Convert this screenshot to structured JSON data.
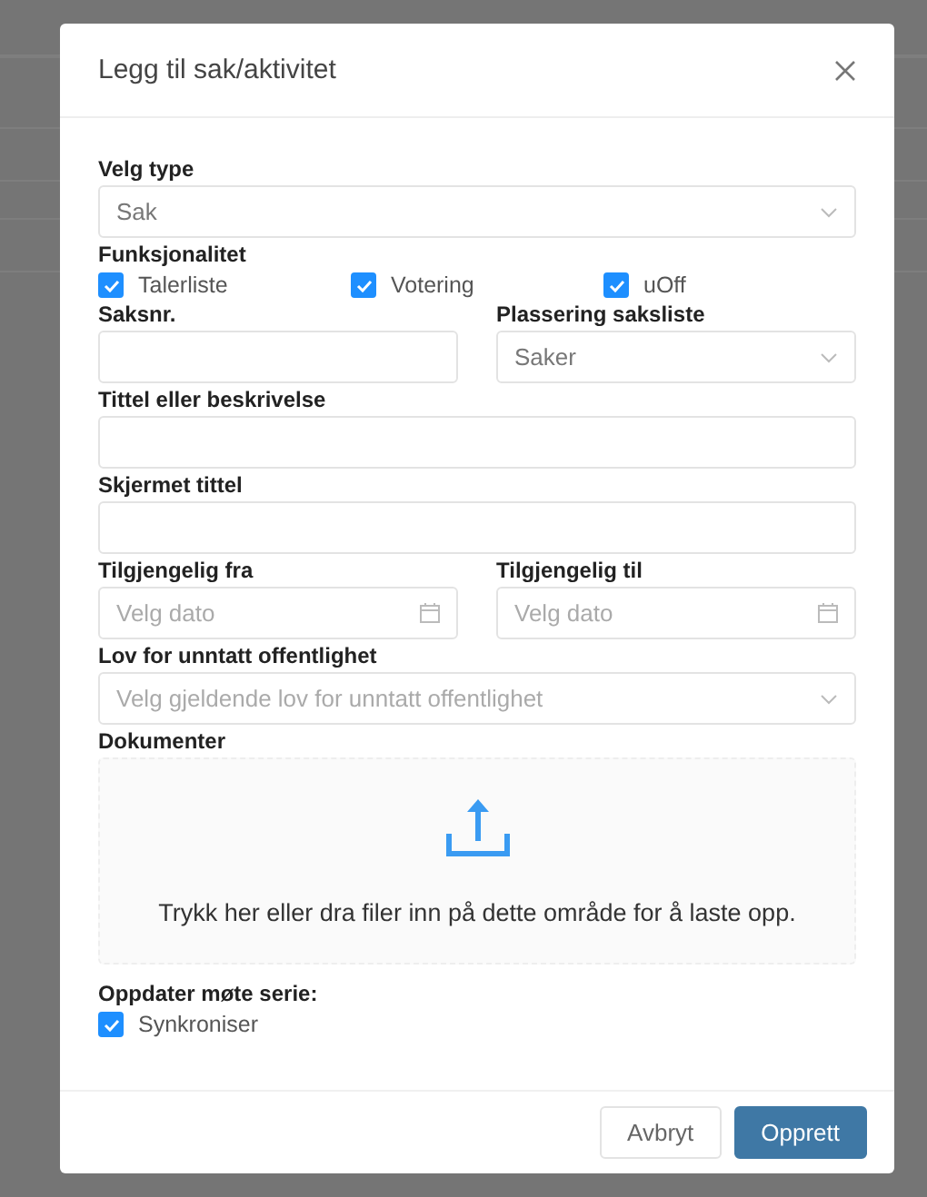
{
  "dialog": {
    "title": "Legg til sak/aktivitet"
  },
  "fields": [
    {
      "kind": "select",
      "label": "Velg type",
      "value": "Sak"
    },
    {
      "kind": "checkboxes",
      "label": "Funksjonalitet",
      "options": [
        {
          "label": "Talerliste",
          "checked": true
        },
        {
          "label": "Votering",
          "checked": true
        },
        {
          "label": "uOff",
          "checked": true
        }
      ]
    },
    {
      "kind": "row",
      "fields": [
        {
          "kind": "text",
          "label": "Saksnr."
        },
        {
          "kind": "select",
          "label": "Plassering saksliste",
          "value": "Saker"
        }
      ]
    },
    {
      "kind": "text",
      "label": "Tittel eller beskrivelse"
    },
    {
      "kind": "text",
      "label": "Skjermet tittel"
    },
    {
      "kind": "row",
      "fields": [
        {
          "kind": "date",
          "label": "Tilgjengelig fra",
          "placeholder": "Velg dato"
        },
        {
          "kind": "date",
          "label": "Tilgjengelig til",
          "placeholder": "Velg dato"
        }
      ]
    },
    {
      "kind": "select",
      "label": "Lov for unntatt offentlighet",
      "placeholder": "Velg gjeldende lov for unntatt offentlighet"
    },
    {
      "kind": "upload",
      "label": "Dokumenter",
      "text": "Trykk her eller dra filer inn på dette område for å laste opp."
    },
    {
      "kind": "checkboxes",
      "label": "Oppdater møte serie:",
      "options": [
        {
          "label": "Synkroniser",
          "checked": true
        }
      ]
    }
  ],
  "buttons": [
    {
      "label": "Avbryt",
      "kind": "secondary"
    },
    {
      "label": "Opprett",
      "kind": "primary"
    }
  ]
}
